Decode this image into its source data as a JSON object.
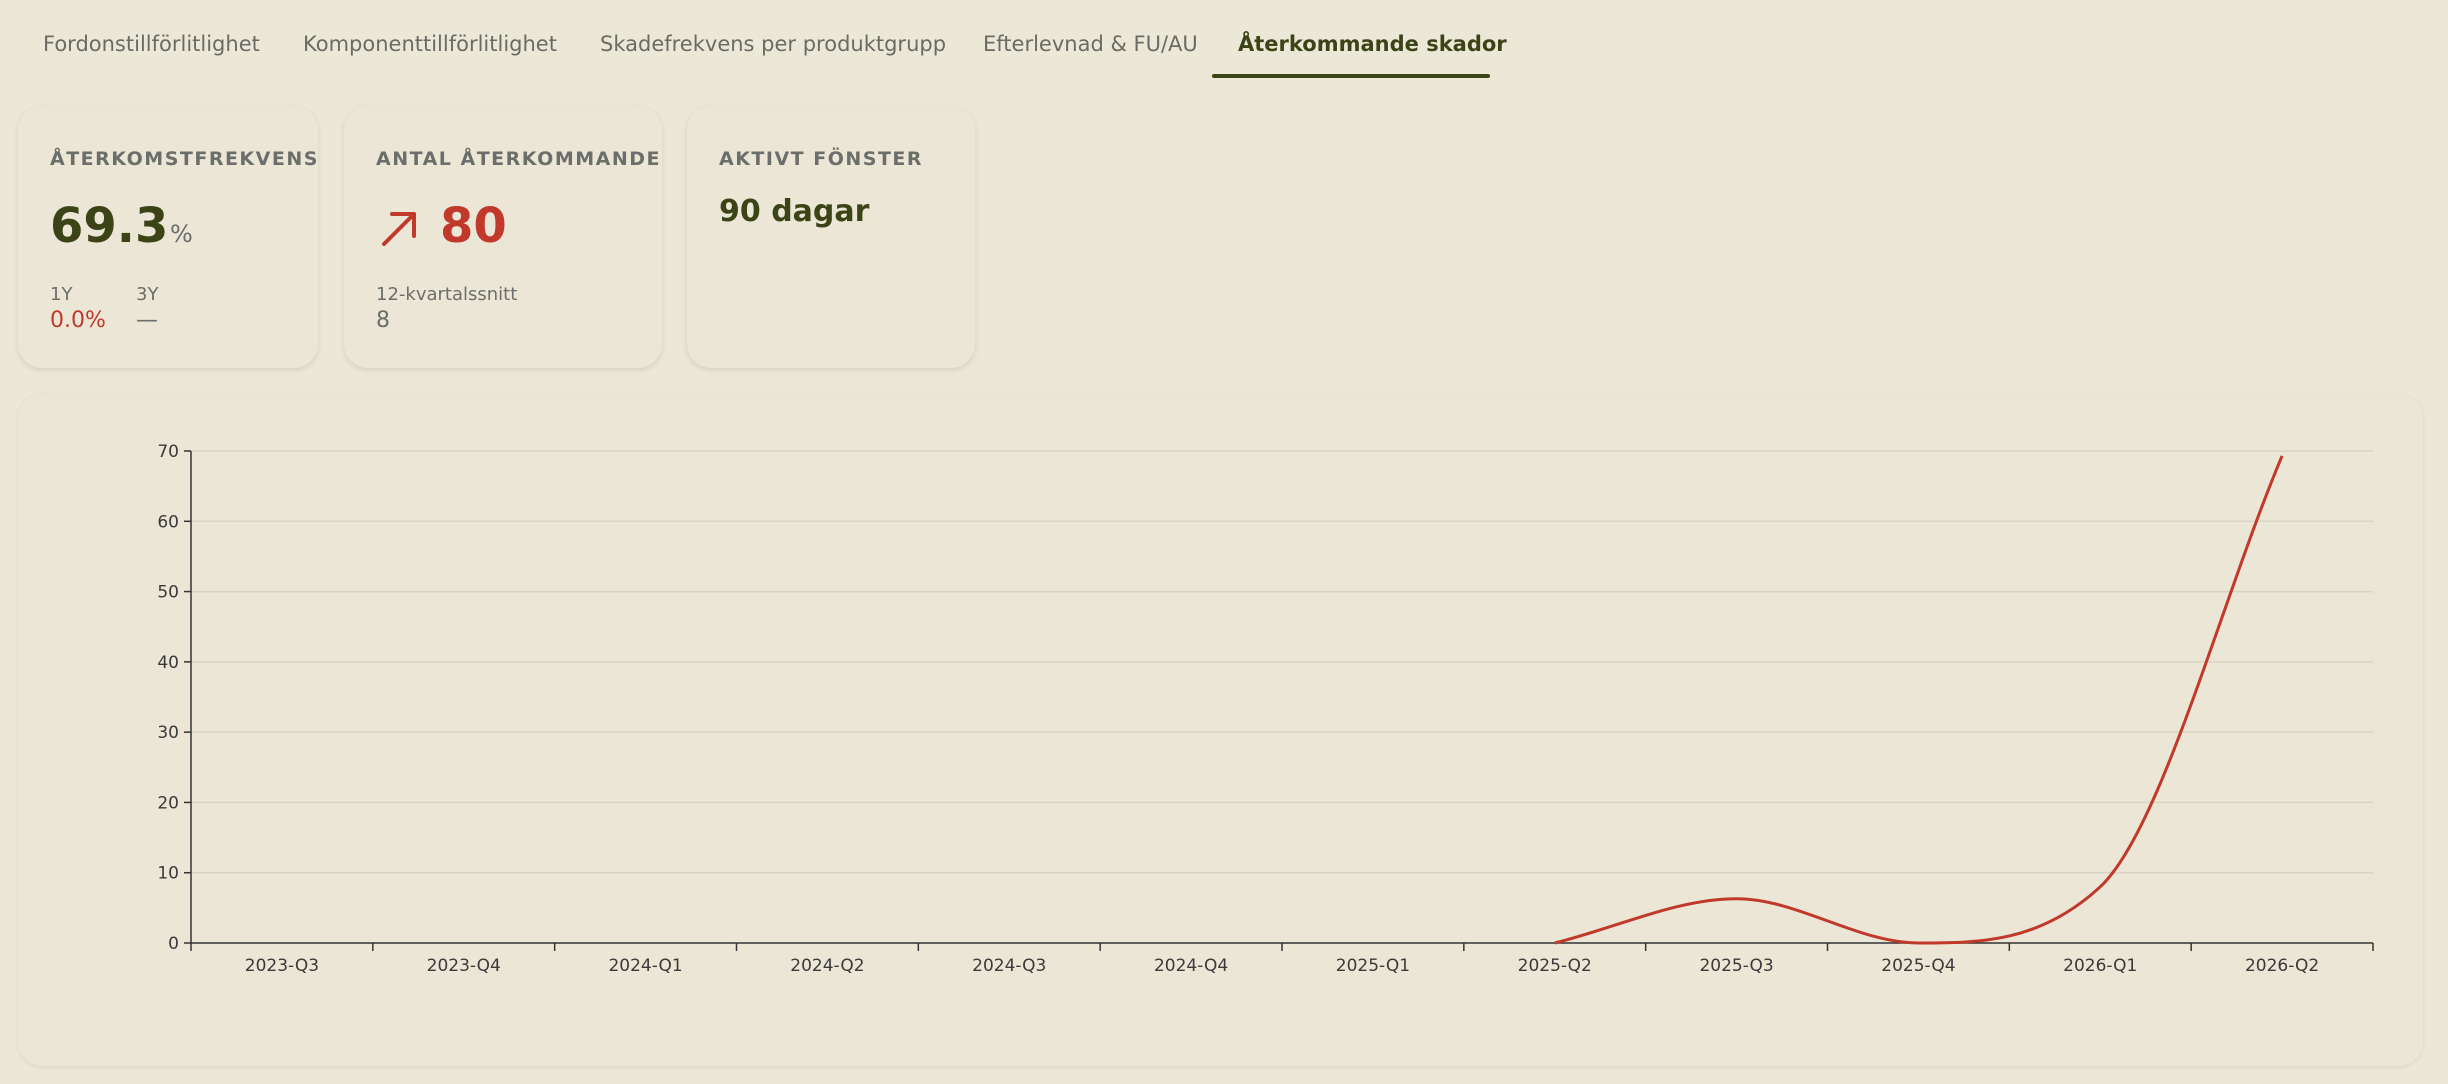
{
  "tabs": [
    {
      "label": "Fordonstillförlitlighet",
      "active": false
    },
    {
      "label": "Komponenttillförlitlighet",
      "active": false
    },
    {
      "label": "Skadefrekvens per produktgrupp",
      "active": false
    },
    {
      "label": "Efterlevnad & FU/AU",
      "active": false
    },
    {
      "label": "Återkommande skador",
      "active": true
    }
  ],
  "kpi": {
    "rate": {
      "title": "ÅTERKOMSTFREKVENS",
      "value": "69.3",
      "unit": "%",
      "y1_label": "1Y",
      "y1_value": "0.0%",
      "y3_label": "3Y",
      "y3_value": "—"
    },
    "count": {
      "title": "ANTAL ÅTERKOMMANDE",
      "value": "80",
      "trend_icon": "arrow-up-right-icon",
      "avg_label": "12-kvartalssnitt",
      "avg_value": "8"
    },
    "window": {
      "title": "AKTIVT FÖNSTER",
      "value": "90 dagar"
    }
  },
  "colors": {
    "accent": "#3b4317",
    "negative": "#c0392b",
    "background": "#ece8d8"
  },
  "chart_data": {
    "type": "line",
    "categories": [
      "2023-Q3",
      "2023-Q4",
      "2024-Q1",
      "2024-Q2",
      "2024-Q3",
      "2024-Q4",
      "2025-Q1",
      "2025-Q2",
      "2025-Q3",
      "2025-Q4",
      "2026-Q1",
      "2026-Q2"
    ],
    "series": [
      {
        "values": [
          null,
          null,
          null,
          null,
          null,
          null,
          null,
          0,
          6.3,
          0,
          8,
          69.3
        ]
      }
    ],
    "yticks": [
      0,
      10,
      20,
      30,
      40,
      50,
      60,
      70
    ],
    "ylim": [
      0,
      70
    ],
    "grid": true,
    "line_color": "#c0392b"
  }
}
